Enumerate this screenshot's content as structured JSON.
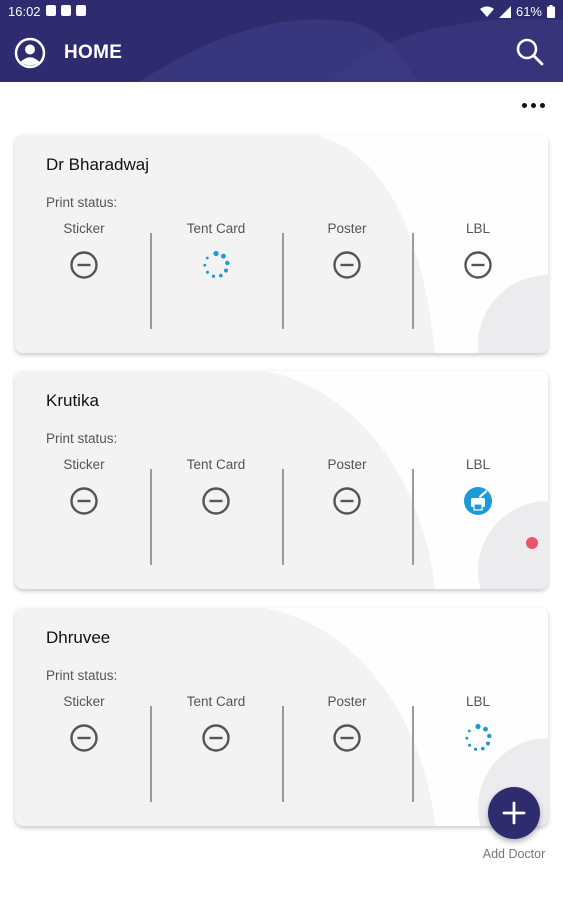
{
  "status_bar": {
    "time": "16:02",
    "battery": "61%"
  },
  "app_bar": {
    "title": "HOME",
    "left_icon": "account-circle-icon",
    "right_icon": "search-icon",
    "color": "#2e2c6e"
  },
  "overflow_menu_icon": "more-horizontal-icon",
  "print_status_label": "Print status:",
  "columns": [
    "Sticker",
    "Tent Card",
    "Poster",
    "LBL"
  ],
  "doctors": [
    {
      "name": "Dr Bharadwaj",
      "statuses": [
        "not-printed",
        "in-progress",
        "not-printed",
        "not-printed"
      ]
    },
    {
      "name": "Krutika",
      "statuses": [
        "not-printed",
        "not-printed",
        "not-printed",
        "printed"
      ],
      "notification_dot": true
    },
    {
      "name": "Dhruvee",
      "statuses": [
        "not-printed",
        "not-printed",
        "not-printed",
        "in-progress"
      ]
    }
  ],
  "status_icons": {
    "not-printed": "minus-circle-icon",
    "in-progress": "loading-spinner-icon",
    "printed": "print-done-icon"
  },
  "colors": {
    "accent_blue": "#1a9ad6",
    "notification_red": "#e8566e",
    "card_bg": "#f3f3f3"
  },
  "fab": {
    "label": "Add Doctor",
    "icon": "plus-icon"
  }
}
